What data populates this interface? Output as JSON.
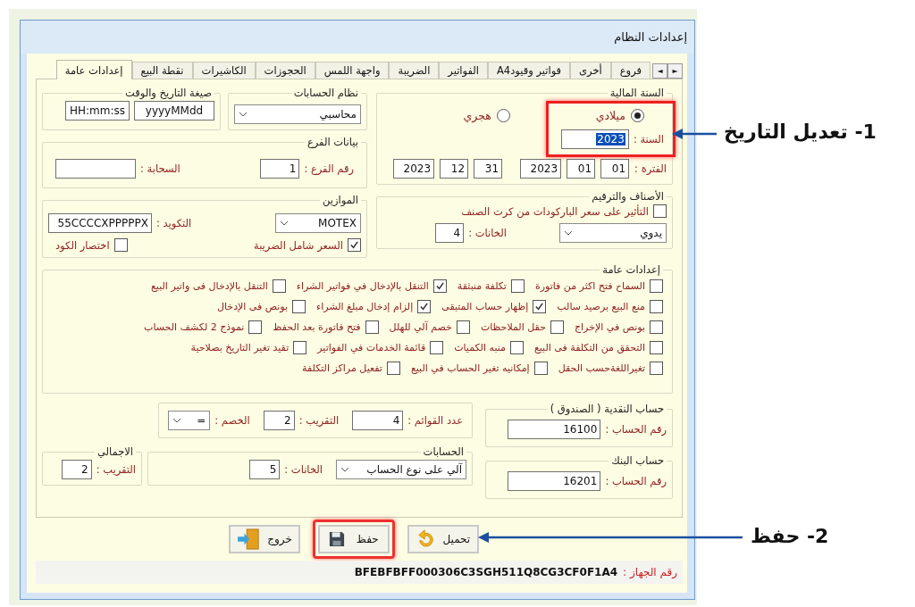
{
  "window": {
    "title": "إعدادات النظام"
  },
  "tab_scroll": [
    "►",
    "◄"
  ],
  "tabs": [
    {
      "label": "فروع",
      "selected": false
    },
    {
      "label": "أخرى",
      "selected": false
    },
    {
      "label": "فواتير وقيودA4",
      "selected": false
    },
    {
      "label": "الفواتير",
      "selected": false
    },
    {
      "label": "الضريبة",
      "selected": false
    },
    {
      "label": "واجهة اللمس",
      "selected": false
    },
    {
      "label": "الحجوزات",
      "selected": false
    },
    {
      "label": "الكاشيرات",
      "selected": false
    },
    {
      "label": "نقطة البيع",
      "selected": false
    },
    {
      "label": "إعدادات عامة",
      "selected": true
    }
  ],
  "fiscal_year": {
    "title": "السنة المالية",
    "highlighted": true,
    "calendars": [
      {
        "label": "ميلادي",
        "selected": true
      },
      {
        "label": "هجري",
        "selected": false
      }
    ],
    "year": {
      "label": "السنة :",
      "value": "2023",
      "text_selected": true
    },
    "period": {
      "label": "الفترة :",
      "from": [
        "01",
        "01",
        "2023"
      ],
      "to": [
        "31",
        "12",
        "2023"
      ]
    }
  },
  "items_numbering": {
    "title": "الأصناف والترقيم",
    "barcode_price": {
      "label": "التأثير على سعر الباركودات من كرت الصنف",
      "checked": false
    },
    "mode": "يدوي",
    "digits": {
      "label": "الخانات :",
      "value": "4"
    }
  },
  "accounts_system": {
    "title": "نظام الحسابات",
    "value": "محاسبي"
  },
  "datetime_format": {
    "title": "صيغة التاريخ والوقت",
    "date": "yyyyMMdd",
    "time": "HH:mm:ss"
  },
  "branch_data": {
    "title": "بيانات الفرع",
    "branch_number": {
      "label": "رقم الفرع :",
      "value": "1"
    },
    "cloud": {
      "label": "السحابة :"
    }
  },
  "scales": {
    "title": "الموازين",
    "model": "MOTEX",
    "coding": {
      "label": "التكويد :",
      "value": "55CCCCXPPPPPX"
    },
    "options": [
      {
        "label": "السعر شامل الضريبة",
        "checked": true
      },
      {
        "label": "اختصار الكود",
        "checked": false
      }
    ]
  },
  "general_settings": {
    "title": "إعدادات عامة",
    "rows": [
      [
        {
          "label": "السماح فتح اكثر من فاتورة",
          "checked": false
        },
        {
          "label": "تكلفة منبثقة",
          "checked": false
        },
        {
          "label": "التنقل بالإدخال في فواتير الشراء",
          "checked": true
        },
        {
          "label": "التنقل بالإدخال فى واتير البيع",
          "checked": false
        }
      ],
      [
        {
          "label": "منع البيع برصيد سالب",
          "checked": false
        },
        {
          "label": "إظهار حساب المتبقى",
          "checked": true
        },
        {
          "label": "إلزام إدخال مبلغ الشراء",
          "checked": true
        },
        {
          "label": "بونص فى الإدخال",
          "checked": false
        }
      ],
      [
        {
          "label": "بونص في الإخراج",
          "checked": false
        },
        {
          "label": "حقل الملاحظات",
          "checked": false
        },
        {
          "label": "خصم آلي للهلل",
          "checked": false
        },
        {
          "label": "فتح فاتورة بعد الحفظ",
          "checked": false
        },
        {
          "label": "نموذج 2 لكشف الحساب",
          "checked": false
        }
      ],
      [
        {
          "label": "التحقق من التكلفة فى البيع",
          "checked": false
        },
        {
          "label": "منبه الكميات",
          "checked": false
        },
        {
          "label": "قائمة الخدمات في الفواتير",
          "checked": false
        },
        {
          "label": "تقيد تغير التاريخ بصلاحية",
          "checked": false
        }
      ],
      [
        {
          "label": "تغيراللغةحسب الحقل",
          "checked": false
        },
        {
          "label": "إمكانيه تغير الحساب في البيع",
          "checked": false
        },
        {
          "label": "تفعيل مراكز التكلفة",
          "checked": false
        }
      ]
    ]
  },
  "cash_account": {
    "title": "حساب النقدية ( الصندوق )",
    "label": "رقم الحساب :",
    "value": "16100"
  },
  "bank_account": {
    "title": "حساب البنك",
    "label": "رقم الحساب :",
    "value": "16201"
  },
  "lists": {
    "list_count": {
      "label": "عدد القوائم :",
      "value": "4"
    },
    "rounding": {
      "label": "التقريب :",
      "value": "2"
    },
    "discount": {
      "label": "الخصم :",
      "value": "="
    }
  },
  "accounts": {
    "title": "الحسابات",
    "mode": "آلي على نوع الحساب",
    "digits": {
      "label": "الخانات :",
      "value": "5"
    }
  },
  "total": {
    "title": "الاجمالي",
    "rounding": {
      "label": "التقريب :",
      "value": "2"
    }
  },
  "buttons": [
    {
      "kind": "load",
      "label": "تحميل",
      "highlighted": false
    },
    {
      "kind": "save",
      "label": "حفظ",
      "highlighted": true
    },
    {
      "kind": "exit",
      "label": "خروج",
      "highlighted": false
    }
  ],
  "status_bar": {
    "label": "رقم الجهاز :",
    "value": "BFEBFBFF000306C3SGH511Q8CG3CF0F1A4"
  },
  "annotations": [
    {
      "text": "1- تعديل التاريخ"
    },
    {
      "text": "2- حفظ"
    }
  ]
}
